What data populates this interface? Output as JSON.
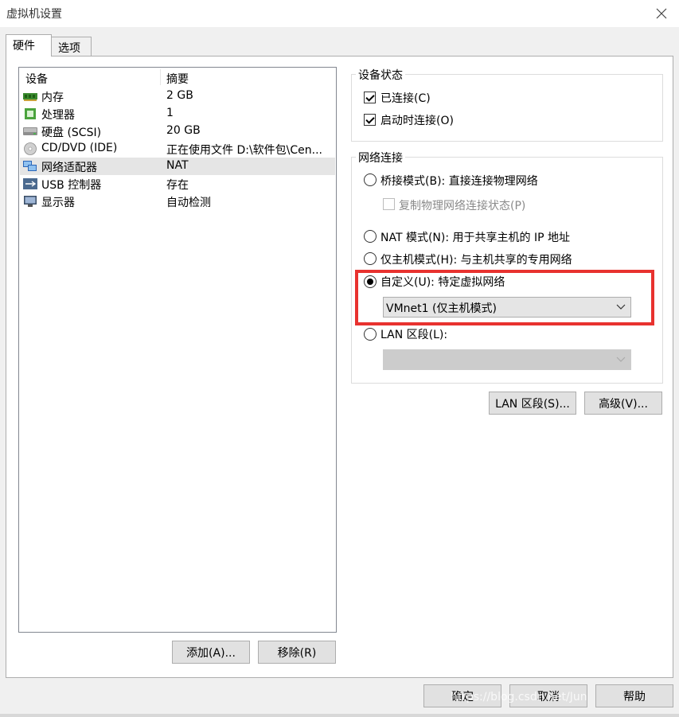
{
  "window": {
    "title": "虚拟机设置"
  },
  "tabs": [
    {
      "label": "硬件",
      "active": true
    },
    {
      "label": "选项",
      "active": false
    }
  ],
  "device_list": {
    "headers": {
      "device": "设备",
      "summary": "摘要"
    },
    "rows": [
      {
        "name": "内存",
        "summary": "2 GB",
        "icon": "memory-icon"
      },
      {
        "name": "处理器",
        "summary": "1",
        "icon": "processor-icon"
      },
      {
        "name": "硬盘 (SCSI)",
        "summary": "20 GB",
        "icon": "harddisk-icon"
      },
      {
        "name": "CD/DVD (IDE)",
        "summary": "正在使用文件 D:\\软件包\\Cen...",
        "icon": "cd-dvd-icon"
      },
      {
        "name": "网络适配器",
        "summary": "NAT",
        "icon": "network-adapter-icon",
        "selected": true
      },
      {
        "name": "USB 控制器",
        "summary": "存在",
        "icon": "usb-icon"
      },
      {
        "name": "显示器",
        "summary": "自动检测",
        "icon": "display-icon"
      }
    ]
  },
  "list_buttons": {
    "add": "添加(A)...",
    "remove": "移除(R)"
  },
  "device_status": {
    "title": "设备状态",
    "connected": {
      "label": "已连接(C)",
      "checked": true
    },
    "connect_on_start": {
      "label": "启动时连接(O)",
      "checked": true
    }
  },
  "network": {
    "title": "网络连接",
    "bridged": {
      "label": "桥接模式(B): 直接连接物理网络",
      "checked": false
    },
    "replicate": {
      "label": "复制物理网络连接状态(P)",
      "checked": false
    },
    "nat": {
      "label": "NAT 模式(N): 用于共享主机的 IP 地址",
      "checked": false
    },
    "host_only": {
      "label": "仅主机模式(H): 与主机共享的专用网络",
      "checked": false
    },
    "custom": {
      "label": "自定义(U): 特定虚拟网络",
      "checked": true
    },
    "custom_select": {
      "value": "VMnet1 (仅主机模式)"
    },
    "lan": {
      "label": "LAN 区段(L):",
      "checked": false
    },
    "lan_select": {
      "value": ""
    }
  },
  "network_buttons": {
    "lan_segments": "LAN 区段(S)...",
    "advanced": "高级(V)..."
  },
  "footer": {
    "ok": "确定",
    "cancel": "取消",
    "help": "帮助"
  },
  "watermark": "https://blog.csdn.net/Jun",
  "colors": {
    "highlight": "#e8322f",
    "selected_row": "#e5e5e5"
  }
}
